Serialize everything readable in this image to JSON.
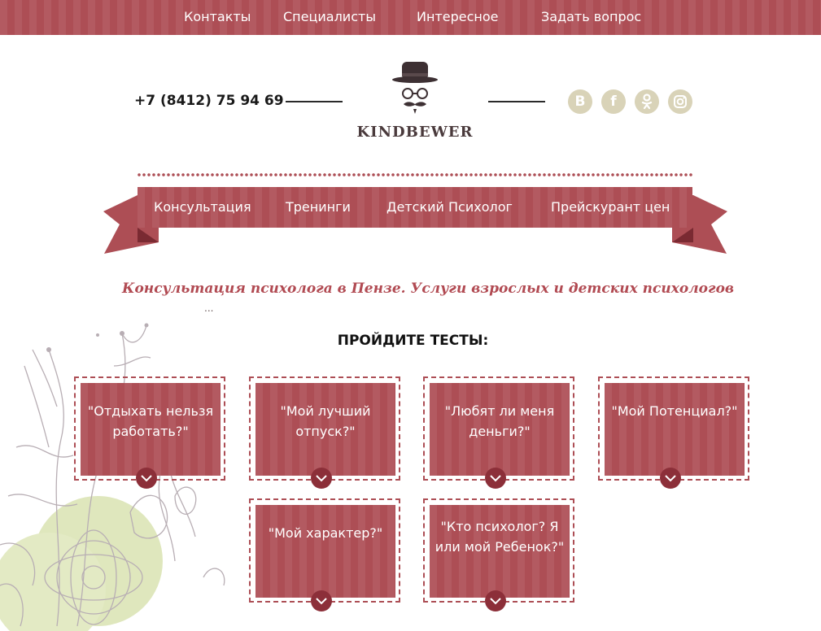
{
  "top_nav": {
    "items": [
      {
        "label": "Контакты"
      },
      {
        "label": "Специалисты"
      },
      {
        "label": "Интересное"
      },
      {
        "label": "Задать вопрос"
      }
    ]
  },
  "header": {
    "phone": "+7 (8412) 75 94 69",
    "brand": "KINDBEWER",
    "social": [
      {
        "icon": "vk-icon",
        "glyph": "B"
      },
      {
        "icon": "facebook-icon",
        "glyph": "f"
      },
      {
        "icon": "odnoklassniki-icon",
        "glyph": "ok"
      },
      {
        "icon": "instagram-icon",
        "glyph": ""
      }
    ]
  },
  "ribbon_nav": {
    "items": [
      {
        "label": "Консультация"
      },
      {
        "label": "Тренинги"
      },
      {
        "label": "Детский Психолог"
      },
      {
        "label": "Прейскурант цен"
      }
    ]
  },
  "main": {
    "heading": "Консультация психолога в Пензе. Услуги взрослых и детских психологов",
    "ellipsis": "...",
    "tests_title": "ПРОЙДИТЕ ТЕСТЫ:",
    "tests": [
      {
        "label": "\"Отдыхать нельзя работать?\""
      },
      {
        "label": "\"Мой лучший отпуск?\""
      },
      {
        "label": "\"Любят ли меня деньги?\""
      },
      {
        "label": "\"Мой Потенциал?\""
      },
      {
        "label": "\"Мой характер?\""
      },
      {
        "label": "\"Кто психолог? Я или мой Ребенок?\""
      }
    ]
  },
  "colors": {
    "accent": "#ad4e55",
    "accent_dark": "#8c2f39",
    "social_bg": "#d9d3b8",
    "flower_green": "#dde6b9"
  }
}
